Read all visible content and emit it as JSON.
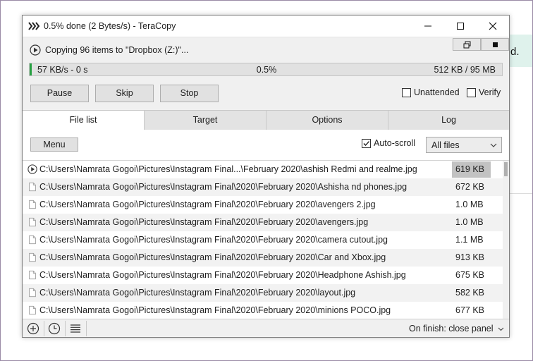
{
  "window": {
    "title": "0.5% done (2 Bytes/s) - TeraCopy",
    "status_text": "Copying 96 items to \"Dropbox (Z:)\"..."
  },
  "progress": {
    "speed_time": "57 KB/s - 0 s",
    "percent_label": "0.5%",
    "fraction": 0.005,
    "size_label": "512 KB / 95 MB"
  },
  "buttons": {
    "pause": "Pause",
    "skip": "Skip",
    "stop": "Stop"
  },
  "options": {
    "unattended": "Unattended",
    "verify": "Verify"
  },
  "tabs": [
    {
      "label": "File list"
    },
    {
      "label": "Target"
    },
    {
      "label": "Options"
    },
    {
      "label": "Log"
    }
  ],
  "file_list": {
    "menu_label": "Menu",
    "auto_scroll_label": "Auto-scroll",
    "filter_value": "All files",
    "files": [
      {
        "path": "C:\\Users\\Namrata Gogoi\\Pictures\\Instagram Final...\\February 2020\\ashish Redmi and realme.jpg",
        "size": "619 KB",
        "status": "copying"
      },
      {
        "path": "C:\\Users\\Namrata Gogoi\\Pictures\\Instagram Final\\2020\\February 2020\\Ashisha nd phones.jpg",
        "size": "672 KB",
        "status": "pending"
      },
      {
        "path": "C:\\Users\\Namrata Gogoi\\Pictures\\Instagram Final\\2020\\February 2020\\avengers 2.jpg",
        "size": "1.0 MB",
        "status": "pending"
      },
      {
        "path": "C:\\Users\\Namrata Gogoi\\Pictures\\Instagram Final\\2020\\February 2020\\avengers.jpg",
        "size": "1.0 MB",
        "status": "pending"
      },
      {
        "path": "C:\\Users\\Namrata Gogoi\\Pictures\\Instagram Final\\2020\\February 2020\\camera cutout.jpg",
        "size": "1.1 MB",
        "status": "pending"
      },
      {
        "path": "C:\\Users\\Namrata Gogoi\\Pictures\\Instagram Final\\2020\\February 2020\\Car and Xbox.jpg",
        "size": "913 KB",
        "status": "pending"
      },
      {
        "path": "C:\\Users\\Namrata Gogoi\\Pictures\\Instagram Final\\2020\\February 2020\\Headphone Ashish.jpg",
        "size": "675 KB",
        "status": "pending"
      },
      {
        "path": "C:\\Users\\Namrata Gogoi\\Pictures\\Instagram Final\\2020\\February 2020\\layout.jpg",
        "size": "582 KB",
        "status": "pending"
      },
      {
        "path": "C:\\Users\\Namrata Gogoi\\Pictures\\Instagram Final\\2020\\February 2020\\minions POCO.jpg",
        "size": "677 KB",
        "status": "pending"
      }
    ]
  },
  "bottom_bar": {
    "on_finish": "On finish: close panel"
  },
  "background": {
    "partial_text": "d."
  },
  "colors": {
    "progress": "#27a042",
    "window_bg": "#f0f0f0",
    "highlight": "#c2c2c2"
  },
  "icons": [
    "teracopy-icon",
    "minimize-icon",
    "maximize-icon",
    "close-icon",
    "play-icon",
    "restore-icon",
    "stop-icon",
    "file-icon",
    "add-icon",
    "history-icon",
    "list-icon",
    "chevron-down-icon"
  ]
}
